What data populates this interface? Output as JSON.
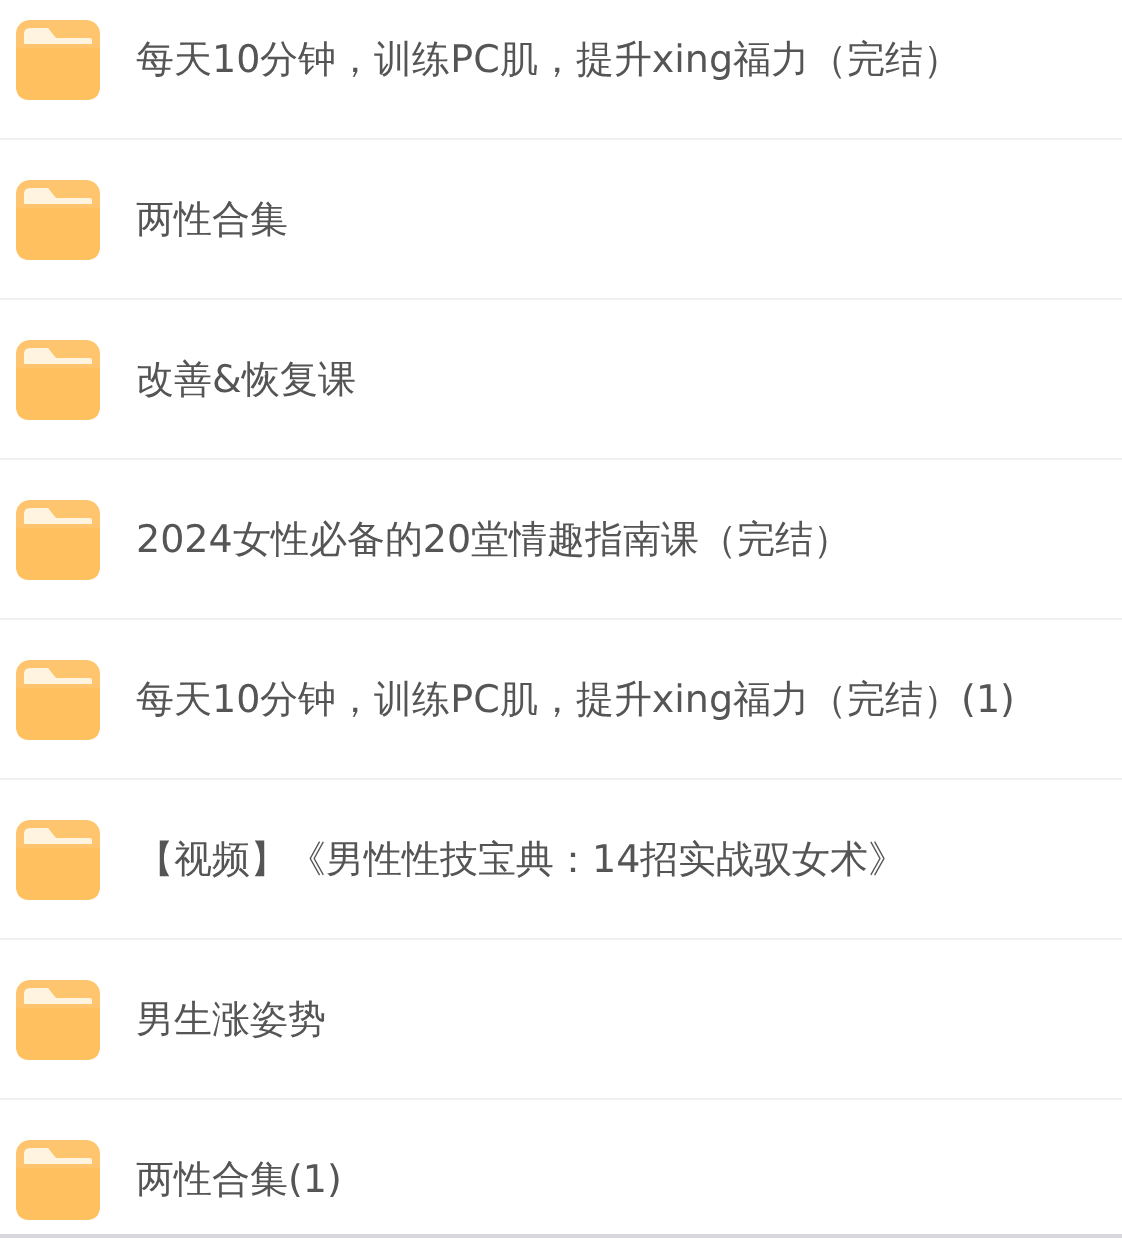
{
  "folders": [
    {
      "name": "每天10分钟，训练PC肌，提升xing福力（完结）"
    },
    {
      "name": "两性合集"
    },
    {
      "name": "改善&恢复课"
    },
    {
      "name": "2024女性必备的20堂情趣指南课（完结）"
    },
    {
      "name": "每天10分钟，训练PC肌，提升xing福力（完结）(1)"
    },
    {
      "name": "【视频】《男性性技宝典：14招实战驭女术》"
    },
    {
      "name": "男生涨姿势"
    },
    {
      "name": "两性合集(1)"
    }
  ]
}
